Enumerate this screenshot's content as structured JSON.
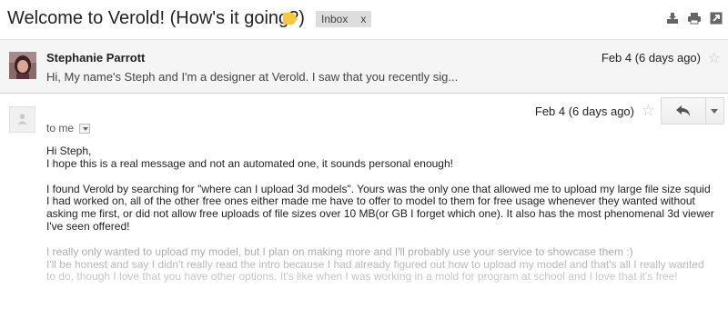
{
  "thread": {
    "subject": "Welcome to Verold! (How's it going?)",
    "label_color": "#f4c842",
    "inbox_label": "Inbox",
    "inbox_remove": "x",
    "icons": [
      "print-all-icon",
      "print-icon",
      "new-window-icon"
    ]
  },
  "collapsed_message": {
    "sender": "Stephanie Parrott",
    "snippet": "Hi, My name's Steph and I'm a designer at Verold. I saw that you recently sig...",
    "date": "Feb 4 (6 days ago)",
    "star": "☆"
  },
  "expanded_message": {
    "to": "to me",
    "date": "Feb 4 (6 days ago)",
    "star": "☆",
    "body": {
      "greeting": "Hi Steph,",
      "line1": "I hope this is a real message and not an automated one, it sounds personal enough!",
      "para2": "I found Verold by searching for \"where can I upload 3d models\". Yours was the only one that allowed me to upload my large file size squid I had worked on, all of the other free ones either made me have to offer to model to them for free usage whenever they wanted without asking me first, or did not allow free uploads of file sizes over 10 MB(or GB I forget which one). It also has the most phenomenal 3d viewer I've seen offered!",
      "para3": "I really only wanted to upload my model, but I plan on making more and I'll probably use your service to showcase them :)",
      "para4": "I'll be honest and say I didn't really read the intro because I had already figured out how to upload my model and that's all I really wanted to do, though I love that you have other options. It's like when I was working in a mold for program at school and I love that it's free!"
    }
  }
}
